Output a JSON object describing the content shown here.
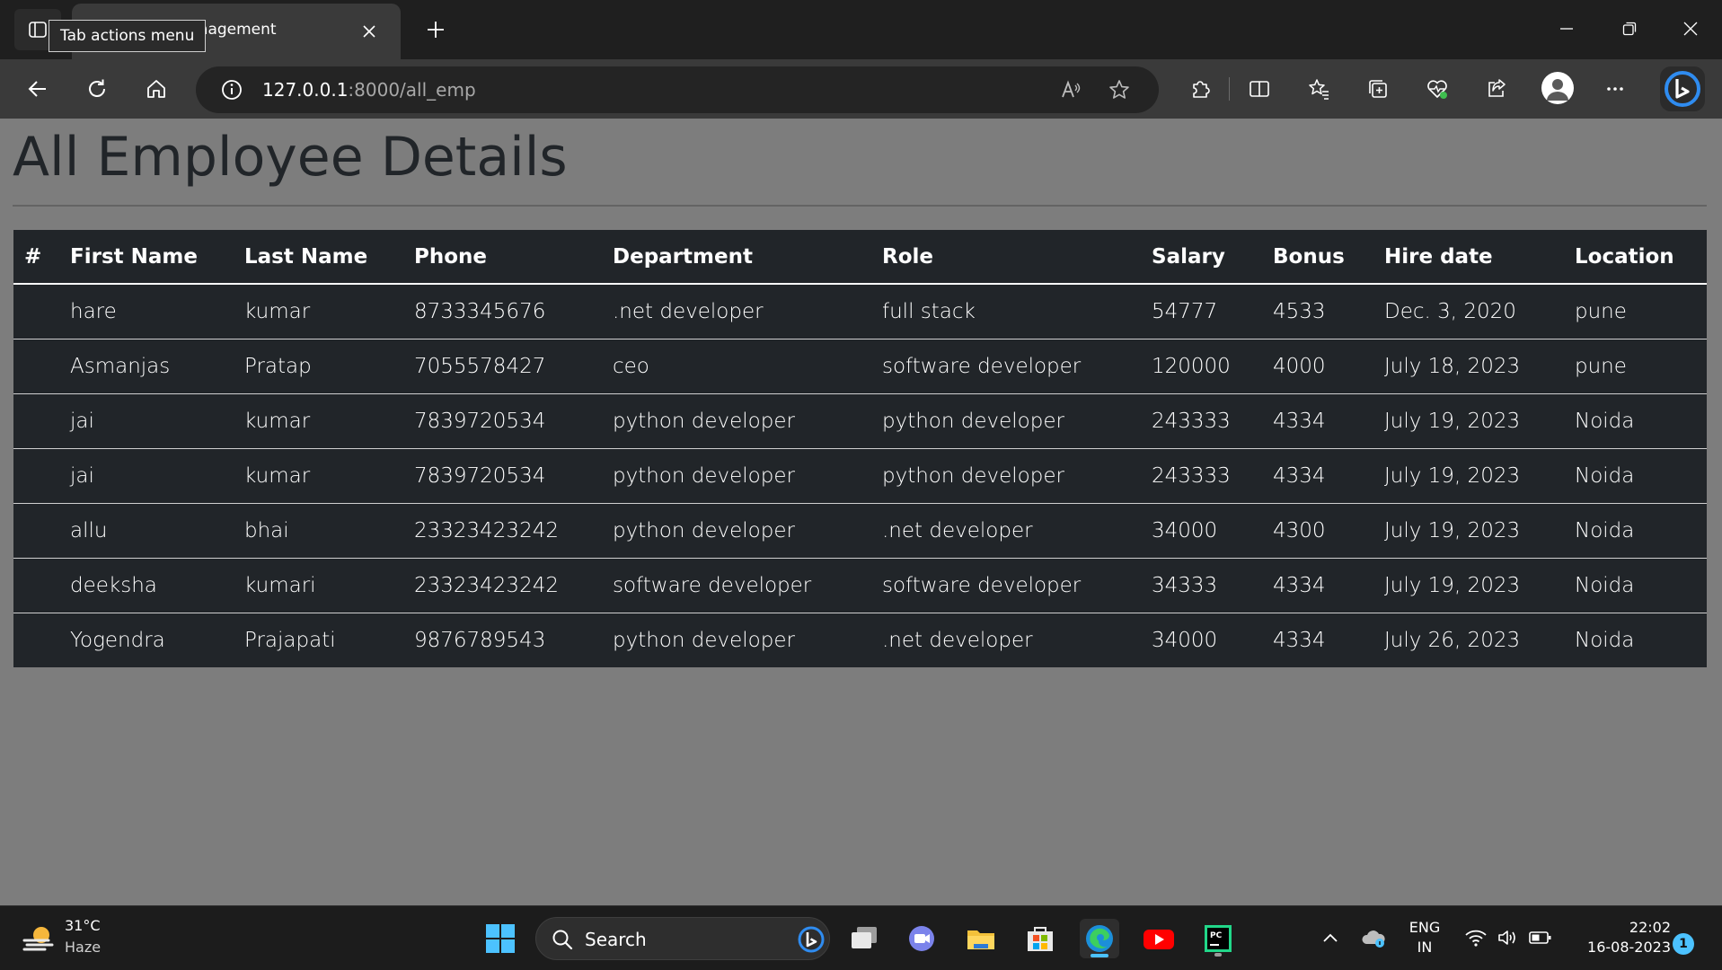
{
  "browser": {
    "tooltip": "Tab actions menu",
    "tab_title": "Employee Management",
    "url_host": "127.0.0.1",
    "url_path": ":8000/all_emp"
  },
  "page": {
    "title": "All Employee Details"
  },
  "table": {
    "headers": [
      "#",
      "First Name",
      "Last Name",
      "Phone",
      "Department",
      "Role",
      "Salary",
      "Bonus",
      "Hire date",
      "Location"
    ],
    "rows": [
      [
        "",
        "hare",
        "kumar",
        "8733345676",
        ".net developer",
        "full stack",
        "54777",
        "4533",
        "Dec. 3, 2020",
        "pune"
      ],
      [
        "",
        "Asmanjas",
        "Pratap",
        "7055578427",
        "ceo",
        "software developer",
        "120000",
        "4000",
        "July 18, 2023",
        "pune"
      ],
      [
        "",
        "jai",
        "kumar",
        "7839720534",
        "python developer",
        "python developer",
        "243333",
        "4334",
        "July 19, 2023",
        "Noida"
      ],
      [
        "",
        "jai",
        "kumar",
        "7839720534",
        "python developer",
        "python developer",
        "243333",
        "4334",
        "July 19, 2023",
        "Noida"
      ],
      [
        "",
        "allu",
        "bhai",
        "23323423242",
        "python developer",
        ".net developer",
        "34000",
        "4300",
        "July 19, 2023",
        "Noida"
      ],
      [
        "",
        "deeksha",
        "kumari",
        "23323423242",
        "software developer",
        "software developer",
        "34333",
        "4334",
        "July 19, 2023",
        "Noida"
      ],
      [
        "",
        "Yogendra",
        "Prajapati",
        "9876789543",
        "python developer",
        ".net developer",
        "34000",
        "4334",
        "July 26, 2023",
        "Noida"
      ]
    ]
  },
  "taskbar": {
    "weather_temp": "31°C",
    "weather_condition": "Haze",
    "search_label": "Search",
    "lang_line1": "ENG",
    "lang_line2": "IN",
    "time": "22:02",
    "date": "16-08-2023",
    "notification_count": "1"
  },
  "colors": {
    "page_background": "#7d7d7d",
    "table_background": "#212529",
    "heading": "#212529",
    "accent": "#4cc2ff"
  }
}
